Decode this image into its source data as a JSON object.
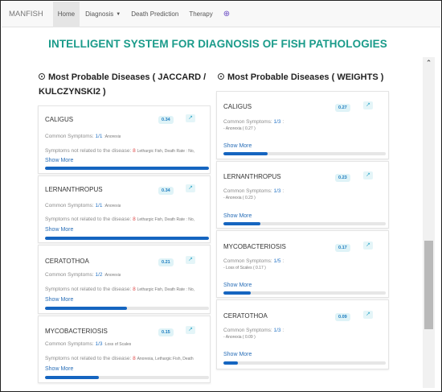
{
  "navbar": {
    "brand": "MANFISH",
    "items": [
      {
        "label": "Home",
        "active": true
      },
      {
        "label": "Diagnosis",
        "dropdown": true
      },
      {
        "label": "Death Prediction"
      },
      {
        "label": "Therapy"
      }
    ],
    "globe_icon": "globe-icon"
  },
  "title": "INTELLIGENT SYSTEM FOR DIAGNOSIS OF FISH PATHOLOGIES",
  "columns": {
    "left": {
      "heading_line1": "Most Probable Diseases ( JACCARD /",
      "heading_line2": "KULCZYNSKI2 )",
      "cards": [
        {
          "name": "CALIGUS",
          "score": "0.34",
          "common_label": "Common Symptoms:",
          "common_value": "1/1",
          "common_detail": ":Anorexia",
          "unrelated_label": "Symptoms not related to the disease:",
          "unrelated_value": "8",
          "unrelated_detail": "Lethargic Fish, Death Rate : No,",
          "show_more": "Show More",
          "progress": 1.0
        },
        {
          "name": "LERNANTHROPUS",
          "score": "0.34",
          "common_label": "Common Symptoms:",
          "common_value": "1/1",
          "common_detail": ":Anorexia",
          "unrelated_label": "Symptoms not related to the disease:",
          "unrelated_value": "8",
          "unrelated_detail": "Lethargic Fish, Death Rate : No,",
          "show_more": "Show More",
          "progress": 1.0
        },
        {
          "name": "CERATOTHOA",
          "score": "0.21",
          "common_label": "Common Symptoms:",
          "common_value": "1/2",
          "common_detail": ":Anorexia",
          "unrelated_label": "Symptoms not related to the disease:",
          "unrelated_value": "8",
          "unrelated_detail": "Lethargic Fish, Death Rate : No,",
          "show_more": "Show More",
          "progress": 0.5
        },
        {
          "name": "MYCOBACTERIOSIS",
          "score": "0.15",
          "common_label": "Common Symptoms:",
          "common_value": "1/3",
          "common_detail": ":Loss of Scales",
          "unrelated_label": "Symptoms not related to the disease:",
          "unrelated_value": "8",
          "unrelated_detail": "Anorexia, Lethargic Fish, Death",
          "show_more": "Show More",
          "progress": 0.33
        }
      ]
    },
    "right": {
      "heading": "Most Probable Diseases ( WEIGHTS )",
      "cards": [
        {
          "name": "CALIGUS",
          "score": "0.27",
          "common_label": "Common Symptoms:",
          "common_value": "1/3",
          "common_suffix": ":",
          "detail": "- Anorexia ( 0.27 )",
          "show_more": "Show More",
          "progress": 0.27
        },
        {
          "name": "LERNANTHROPUS",
          "score": "0.23",
          "common_label": "Common Symptoms:",
          "common_value": "1/3",
          "common_suffix": ":",
          "detail": "- Anorexia ( 0.23 )",
          "show_more": "Show More",
          "progress": 0.23
        },
        {
          "name": "MYCOBACTERIOSIS",
          "score": "0.17",
          "common_label": "Common Symptoms:",
          "common_value": "1/5",
          "common_suffix": ":",
          "detail": "- Loss of Scales ( 0.17 )",
          "show_more": "Show More",
          "progress": 0.17
        },
        {
          "name": "CERATOTHOA",
          "score": "0.09",
          "common_label": "Common Symptoms:",
          "common_value": "1/3",
          "common_suffix": ":",
          "detail": "- Anorexia ( 0.09 )",
          "show_more": "Show More",
          "progress": 0.09
        }
      ]
    }
  },
  "colors": {
    "title": "#1a9b8a",
    "progress": "#1565c0",
    "link": "#2a6fb8",
    "count_red": "#e04848",
    "count_blue": "#2a77c7"
  }
}
